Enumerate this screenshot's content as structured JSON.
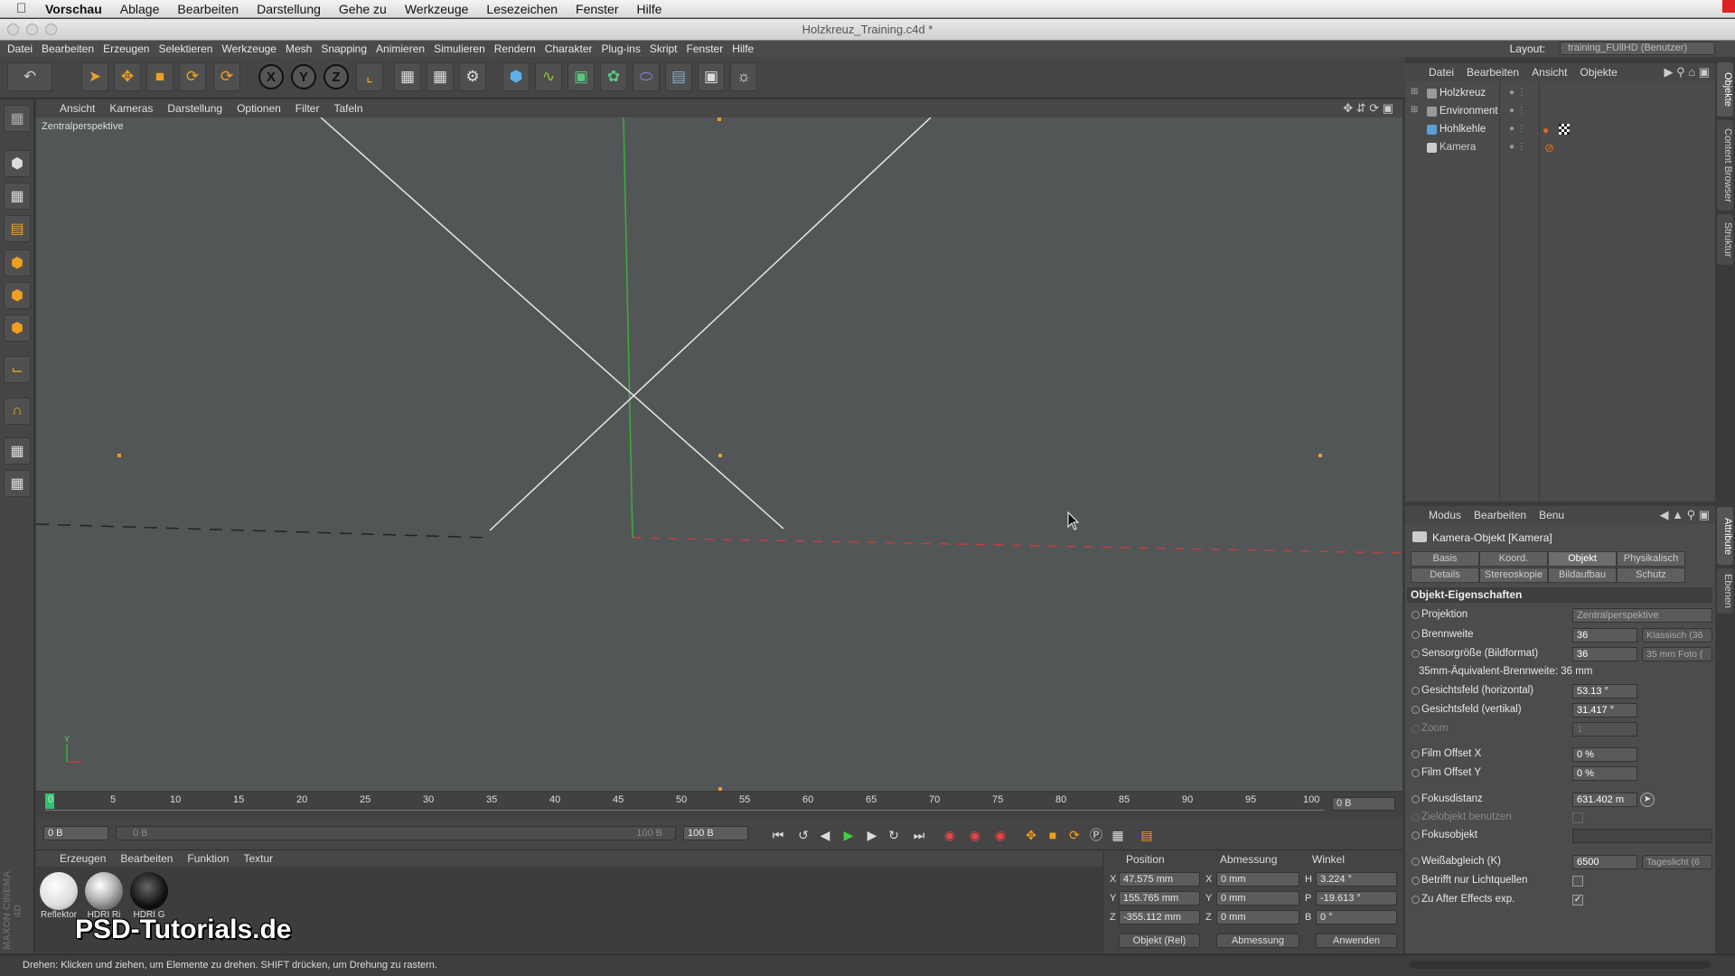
{
  "mac_menu": {
    "app": "Vorschau",
    "items": [
      "Ablage",
      "Bearbeiten",
      "Darstellung",
      "Gehe zu",
      "Werkzeuge",
      "Lesezeichen",
      "Fenster",
      "Hilfe"
    ]
  },
  "window": {
    "title": "Holzkreuz_Training.c4d *"
  },
  "app_menu": {
    "items": [
      "Datei",
      "Bearbeiten",
      "Erzeugen",
      "Selektieren",
      "Werkzeuge",
      "Mesh",
      "Snapping",
      "Animieren",
      "Simulieren",
      "Rendern",
      "Charakter",
      "Plug-ins",
      "Skript",
      "Fenster",
      "Hilfe"
    ],
    "layout_label": "Layout:",
    "layout_value": "training_FUllHD (Benutzer)"
  },
  "toolbar": {
    "axis_x": "X",
    "axis_y": "Y",
    "axis_z": "Z"
  },
  "viewport": {
    "menu": [
      "Ansicht",
      "Kameras",
      "Darstellung",
      "Optionen",
      "Filter",
      "Tafeln"
    ],
    "label": "Zentralperspektive",
    "axis_y": "Y"
  },
  "timeline": {
    "ticks": [
      "0",
      "5",
      "10",
      "15",
      "20",
      "25",
      "30",
      "35",
      "40",
      "45",
      "50",
      "55",
      "60",
      "65",
      "70",
      "75",
      "80",
      "85",
      "90",
      "95",
      "100"
    ],
    "current_frame": "0 B",
    "start": "0 B",
    "range_start": "0 B",
    "range_end": "100 B",
    "end": "100 B"
  },
  "materials": {
    "menu": [
      "Erzeugen",
      "Bearbeiten",
      "Funktion",
      "Textur"
    ],
    "items": [
      {
        "name": "Reflektor",
        "color": "#f0f0f0"
      },
      {
        "name": "HDRI Ri",
        "color": "#cfcfcf"
      },
      {
        "name": "HDRI G",
        "color": "#202020"
      }
    ]
  },
  "branding": {
    "maxon": "MAXON CINEMA 4D",
    "watermark": "PSD-Tutorials.de"
  },
  "coordinates": {
    "headers": [
      "Position",
      "Abmessung",
      "Winkel"
    ],
    "rows": [
      {
        "axis": "X",
        "pos": "47.575 mm",
        "size_axis": "X",
        "size": "0 mm",
        "rot_axis": "H",
        "rot": "3.224 °"
      },
      {
        "axis": "Y",
        "pos": "155.765 mm",
        "size_axis": "Y",
        "size": "0 mm",
        "rot_axis": "P",
        "rot": "-19.613 °"
      },
      {
        "axis": "Z",
        "pos": "-355.112 mm",
        "size_axis": "Z",
        "size": "0 mm",
        "rot_axis": "B",
        "rot": "0 °"
      }
    ],
    "mode": "Objekt (Rel)",
    "size_mode": "Abmessung",
    "apply": "Anwenden"
  },
  "status": "Drehen: Klicken und ziehen, um Elemente zu drehen. SHIFT drücken, um Drehung zu rastern.",
  "object_manager": {
    "menu": [
      "Datei",
      "Bearbeiten",
      "Ansicht",
      "Objekte"
    ],
    "objects": [
      {
        "name": "Holzkreuz",
        "color": "#9a9a9a"
      },
      {
        "name": "Environment",
        "color": "#9a9a9a"
      },
      {
        "name": "Hohlkehle",
        "color": "#5aa0d8"
      },
      {
        "name": "Kamera",
        "color": "#cccccc"
      }
    ]
  },
  "side_tabs": [
    "Objekte",
    "Content Browser",
    "Struktur",
    "Attribute",
    "Ebenen"
  ],
  "attributes": {
    "menu": [
      "Modus",
      "Bearbeiten",
      "Benu"
    ],
    "title": "Kamera-Objekt [Kamera]",
    "tabs_row1": [
      "Basis",
      "Koord.",
      "Objekt",
      "Physikalisch"
    ],
    "tabs_row2": [
      "Details",
      "Stereoskopie",
      "Bildaufbau",
      "Schutz"
    ],
    "section": "Objekt-Eigenschaften",
    "projektion": {
      "label": "Projektion",
      "value": "Zentralperspektive"
    },
    "brennweite": {
      "label": "Brennweite",
      "value": "36",
      "extra": "Klassisch (36"
    },
    "sensor": {
      "label": "Sensorgröße (Bildformat)",
      "value": "36",
      "extra": "35 mm Foto ("
    },
    "aequivalent": "35mm-Äquivalent-Brennweite: 36 mm",
    "fov_h": {
      "label": "Gesichtsfeld (horizontal)",
      "value": "53.13 °"
    },
    "fov_v": {
      "label": "Gesichtsfeld (vertikal)",
      "value": "31.417 °"
    },
    "zoom": {
      "label": "Zoom",
      "value": "1"
    },
    "offset_x": {
      "label": "Film Offset X",
      "value": "0 %"
    },
    "offset_y": {
      "label": "Film Offset Y",
      "value": "0 %"
    },
    "fokus": {
      "label": "Fokusdistanz",
      "value": "631.402 m"
    },
    "ziel": {
      "label": "Zielobjekt benutzen"
    },
    "fokusobjekt": {
      "label": "Fokusobjekt"
    },
    "weiss": {
      "label": "Weißabgleich (K)",
      "value": "6500",
      "extra": "Tageslicht (6"
    },
    "licht": {
      "label": "Betrifft nur Lichtquellen"
    },
    "ae": {
      "label": "Zu After Effects exp.",
      "check": "✓"
    }
  },
  "colors": {
    "accent_tab": "#6d6d6d",
    "axis_green": "#44c444",
    "axis_red": "#d04040",
    "handle": "#e89a2c"
  }
}
